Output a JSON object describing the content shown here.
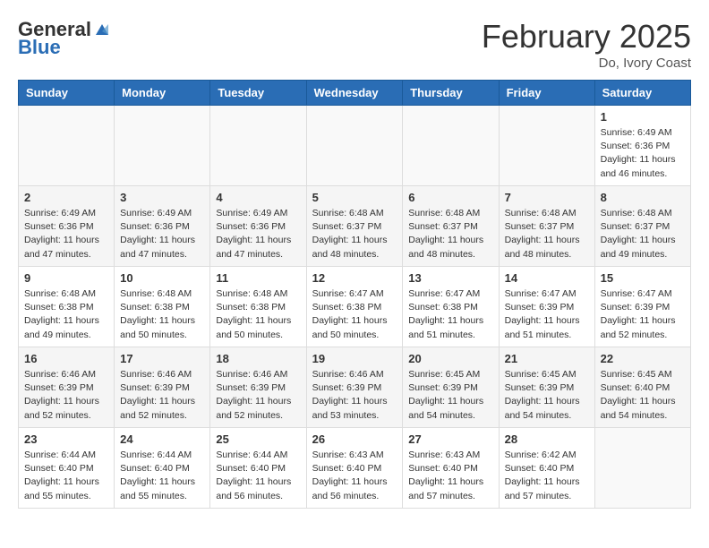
{
  "header": {
    "logo_general": "General",
    "logo_blue": "Blue",
    "month_year": "February 2025",
    "location": "Do, Ivory Coast"
  },
  "days_of_week": [
    "Sunday",
    "Monday",
    "Tuesday",
    "Wednesday",
    "Thursday",
    "Friday",
    "Saturday"
  ],
  "weeks": [
    [
      {
        "day": "",
        "info": ""
      },
      {
        "day": "",
        "info": ""
      },
      {
        "day": "",
        "info": ""
      },
      {
        "day": "",
        "info": ""
      },
      {
        "day": "",
        "info": ""
      },
      {
        "day": "",
        "info": ""
      },
      {
        "day": "1",
        "info": "Sunrise: 6:49 AM\nSunset: 6:36 PM\nDaylight: 11 hours\nand 46 minutes."
      }
    ],
    [
      {
        "day": "2",
        "info": "Sunrise: 6:49 AM\nSunset: 6:36 PM\nDaylight: 11 hours\nand 47 minutes."
      },
      {
        "day": "3",
        "info": "Sunrise: 6:49 AM\nSunset: 6:36 PM\nDaylight: 11 hours\nand 47 minutes."
      },
      {
        "day": "4",
        "info": "Sunrise: 6:49 AM\nSunset: 6:36 PM\nDaylight: 11 hours\nand 47 minutes."
      },
      {
        "day": "5",
        "info": "Sunrise: 6:48 AM\nSunset: 6:37 PM\nDaylight: 11 hours\nand 48 minutes."
      },
      {
        "day": "6",
        "info": "Sunrise: 6:48 AM\nSunset: 6:37 PM\nDaylight: 11 hours\nand 48 minutes."
      },
      {
        "day": "7",
        "info": "Sunrise: 6:48 AM\nSunset: 6:37 PM\nDaylight: 11 hours\nand 48 minutes."
      },
      {
        "day": "8",
        "info": "Sunrise: 6:48 AM\nSunset: 6:37 PM\nDaylight: 11 hours\nand 49 minutes."
      }
    ],
    [
      {
        "day": "9",
        "info": "Sunrise: 6:48 AM\nSunset: 6:38 PM\nDaylight: 11 hours\nand 49 minutes."
      },
      {
        "day": "10",
        "info": "Sunrise: 6:48 AM\nSunset: 6:38 PM\nDaylight: 11 hours\nand 50 minutes."
      },
      {
        "day": "11",
        "info": "Sunrise: 6:48 AM\nSunset: 6:38 PM\nDaylight: 11 hours\nand 50 minutes."
      },
      {
        "day": "12",
        "info": "Sunrise: 6:47 AM\nSunset: 6:38 PM\nDaylight: 11 hours\nand 50 minutes."
      },
      {
        "day": "13",
        "info": "Sunrise: 6:47 AM\nSunset: 6:38 PM\nDaylight: 11 hours\nand 51 minutes."
      },
      {
        "day": "14",
        "info": "Sunrise: 6:47 AM\nSunset: 6:39 PM\nDaylight: 11 hours\nand 51 minutes."
      },
      {
        "day": "15",
        "info": "Sunrise: 6:47 AM\nSunset: 6:39 PM\nDaylight: 11 hours\nand 52 minutes."
      }
    ],
    [
      {
        "day": "16",
        "info": "Sunrise: 6:46 AM\nSunset: 6:39 PM\nDaylight: 11 hours\nand 52 minutes."
      },
      {
        "day": "17",
        "info": "Sunrise: 6:46 AM\nSunset: 6:39 PM\nDaylight: 11 hours\nand 52 minutes."
      },
      {
        "day": "18",
        "info": "Sunrise: 6:46 AM\nSunset: 6:39 PM\nDaylight: 11 hours\nand 52 minutes."
      },
      {
        "day": "19",
        "info": "Sunrise: 6:46 AM\nSunset: 6:39 PM\nDaylight: 11 hours\nand 53 minutes."
      },
      {
        "day": "20",
        "info": "Sunrise: 6:45 AM\nSunset: 6:39 PM\nDaylight: 11 hours\nand 54 minutes."
      },
      {
        "day": "21",
        "info": "Sunrise: 6:45 AM\nSunset: 6:39 PM\nDaylight: 11 hours\nand 54 minutes."
      },
      {
        "day": "22",
        "info": "Sunrise: 6:45 AM\nSunset: 6:40 PM\nDaylight: 11 hours\nand 54 minutes."
      }
    ],
    [
      {
        "day": "23",
        "info": "Sunrise: 6:44 AM\nSunset: 6:40 PM\nDaylight: 11 hours\nand 55 minutes."
      },
      {
        "day": "24",
        "info": "Sunrise: 6:44 AM\nSunset: 6:40 PM\nDaylight: 11 hours\nand 55 minutes."
      },
      {
        "day": "25",
        "info": "Sunrise: 6:44 AM\nSunset: 6:40 PM\nDaylight: 11 hours\nand 56 minutes."
      },
      {
        "day": "26",
        "info": "Sunrise: 6:43 AM\nSunset: 6:40 PM\nDaylight: 11 hours\nand 56 minutes."
      },
      {
        "day": "27",
        "info": "Sunrise: 6:43 AM\nSunset: 6:40 PM\nDaylight: 11 hours\nand 57 minutes."
      },
      {
        "day": "28",
        "info": "Sunrise: 6:42 AM\nSunset: 6:40 PM\nDaylight: 11 hours\nand 57 minutes."
      },
      {
        "day": "",
        "info": ""
      }
    ]
  ]
}
